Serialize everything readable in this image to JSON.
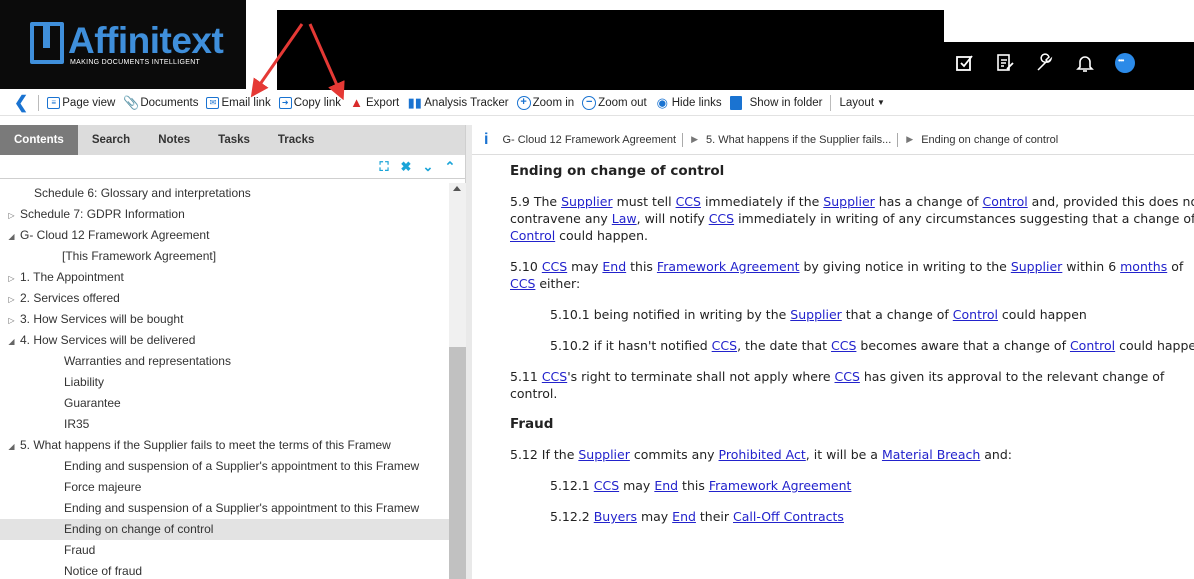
{
  "brand": {
    "name": "Affinitext",
    "tagline": "MAKING DOCUMENTS INTELLIGENT"
  },
  "header_icons": [
    "checkbox-icon",
    "edit-document-icon",
    "wrench-icon",
    "bell-icon",
    "chat-icon"
  ],
  "toolbar": {
    "page_view": "Page view",
    "documents": "Documents",
    "email_link": "Email link",
    "copy_link": "Copy link",
    "export": "Export",
    "analysis_tracker": "Analysis Tracker",
    "zoom_in": "Zoom in",
    "zoom_out": "Zoom out",
    "hide_links": "Hide links",
    "show_in_folder": "Show in folder",
    "layout": "Layout"
  },
  "tabs": [
    "Contents",
    "Search",
    "Notes",
    "Tasks",
    "Tracks"
  ],
  "tree": [
    {
      "label": "Schedule 6: Glossary and interpretations",
      "indent": 1,
      "toggle": ""
    },
    {
      "label": "Schedule 7: GDPR Information",
      "indent": 0,
      "toggle": "▷"
    },
    {
      "label": "G- Cloud 12 Framework Agreement",
      "indent": 0,
      "toggle": "◢"
    },
    {
      "label": "[This Framework Agreement]",
      "indent": 2,
      "toggle": ""
    },
    {
      "label": "1. The Appointment",
      "indent": 1,
      "toggle": "▷"
    },
    {
      "label": "2. Services offered",
      "indent": 1,
      "toggle": "▷"
    },
    {
      "label": "3. How Services will be bought",
      "indent": 1,
      "toggle": "▷"
    },
    {
      "label": "4. How Services will be delivered",
      "indent": 1,
      "toggle": "◢"
    },
    {
      "label": "Warranties and representations",
      "indent": 3,
      "toggle": ""
    },
    {
      "label": "Liability",
      "indent": 3,
      "toggle": ""
    },
    {
      "label": "Guarantee",
      "indent": 3,
      "toggle": ""
    },
    {
      "label": "IR35",
      "indent": 3,
      "toggle": ""
    },
    {
      "label": "5. What happens if the Supplier fails to meet the terms of this Framew",
      "indent": 1,
      "toggle": "◢"
    },
    {
      "label": "Ending and suspension of a Supplier's appointment to this Framew",
      "indent": 3,
      "toggle": ""
    },
    {
      "label": "Force majeure",
      "indent": 3,
      "toggle": ""
    },
    {
      "label": "Ending and suspension of a Supplier's appointment to this Framew",
      "indent": 3,
      "toggle": ""
    },
    {
      "label": "Ending on change of control",
      "indent": 3,
      "toggle": "",
      "selected": true
    },
    {
      "label": "Fraud",
      "indent": 3,
      "toggle": ""
    },
    {
      "label": "Notice of fraud",
      "indent": 3,
      "toggle": ""
    }
  ],
  "breadcrumb": [
    "G- Cloud 12 Framework Agreement",
    "5. What happens if the Supplier fails...",
    "Ending on change of control"
  ],
  "document": {
    "heading1": "Ending on change of control",
    "paragraphs": [
      {
        "indent": false,
        "parts": [
          {
            "t": "5.9  The "
          },
          {
            "t": "Supplier",
            "link": true
          },
          {
            "t": " must tell "
          },
          {
            "t": "CCS",
            "link": true
          },
          {
            "t": " immediately if the "
          },
          {
            "t": "Supplier",
            "link": true
          },
          {
            "t": " has a change of "
          },
          {
            "t": "Control",
            "link": true
          },
          {
            "t": " and, provided this does not contravene any "
          },
          {
            "t": "Law",
            "link": true
          },
          {
            "t": ", will notify "
          },
          {
            "t": "CCS",
            "link": true
          },
          {
            "t": " immediately in writing of any circumstances suggesting that a change of "
          },
          {
            "t": "Control",
            "link": true
          },
          {
            "t": " could happen."
          }
        ]
      },
      {
        "indent": false,
        "parts": [
          {
            "t": "5.10  "
          },
          {
            "t": "CCS",
            "link": true
          },
          {
            "t": " may "
          },
          {
            "t": "End",
            "link": true
          },
          {
            "t": " this "
          },
          {
            "t": "Framework Agreement",
            "link": true
          },
          {
            "t": " by giving notice in writing to the "
          },
          {
            "t": "Supplier",
            "link": true
          },
          {
            "t": " within 6 "
          },
          {
            "t": "months",
            "link": true
          },
          {
            "t": " of "
          },
          {
            "t": "CCS",
            "link": true
          },
          {
            "t": " either:"
          }
        ]
      },
      {
        "indent": true,
        "parts": [
          {
            "t": "5.10.1  being notified in writing by the "
          },
          {
            "t": "Supplier",
            "link": true
          },
          {
            "t": " that a change of "
          },
          {
            "t": "Control",
            "link": true
          },
          {
            "t": " could happen"
          }
        ]
      },
      {
        "indent": true,
        "parts": [
          {
            "t": "5.10.2  if it hasn't notified "
          },
          {
            "t": "CCS",
            "link": true
          },
          {
            "t": ", the date that "
          },
          {
            "t": "CCS",
            "link": true
          },
          {
            "t": " becomes aware that a change of "
          },
          {
            "t": "Control",
            "link": true
          },
          {
            "t": " could happen"
          }
        ]
      },
      {
        "indent": false,
        "parts": [
          {
            "t": "5.11  "
          },
          {
            "t": "CCS",
            "link": true
          },
          {
            "t": "'s right to terminate shall not apply where "
          },
          {
            "t": "CCS",
            "link": true
          },
          {
            "t": " has given its approval to the relevant change of control."
          }
        ]
      }
    ],
    "heading2": "Fraud",
    "paragraphs2": [
      {
        "indent": false,
        "parts": [
          {
            "t": "5.12  If the "
          },
          {
            "t": "Supplier",
            "link": true
          },
          {
            "t": " commits any "
          },
          {
            "t": "Prohibited Act",
            "link": true
          },
          {
            "t": ", it will be a "
          },
          {
            "t": "Material Breach",
            "link": true
          },
          {
            "t": " and:"
          }
        ]
      },
      {
        "indent": true,
        "parts": [
          {
            "t": "5.12.1  "
          },
          {
            "t": "CCS",
            "link": true
          },
          {
            "t": " may "
          },
          {
            "t": "End",
            "link": true
          },
          {
            "t": " this "
          },
          {
            "t": "Framework Agreement",
            "link": true
          }
        ]
      },
      {
        "indent": true,
        "parts": [
          {
            "t": "5.12.2  "
          },
          {
            "t": "Buyers",
            "link": true
          },
          {
            "t": " may "
          },
          {
            "t": "End",
            "link": true
          },
          {
            "t": " their "
          },
          {
            "t": "Call-Off Contracts",
            "link": true
          }
        ]
      }
    ]
  },
  "colors": {
    "accent": "#1a73d1",
    "link": "#2222cc",
    "arrow": "#e53935"
  }
}
